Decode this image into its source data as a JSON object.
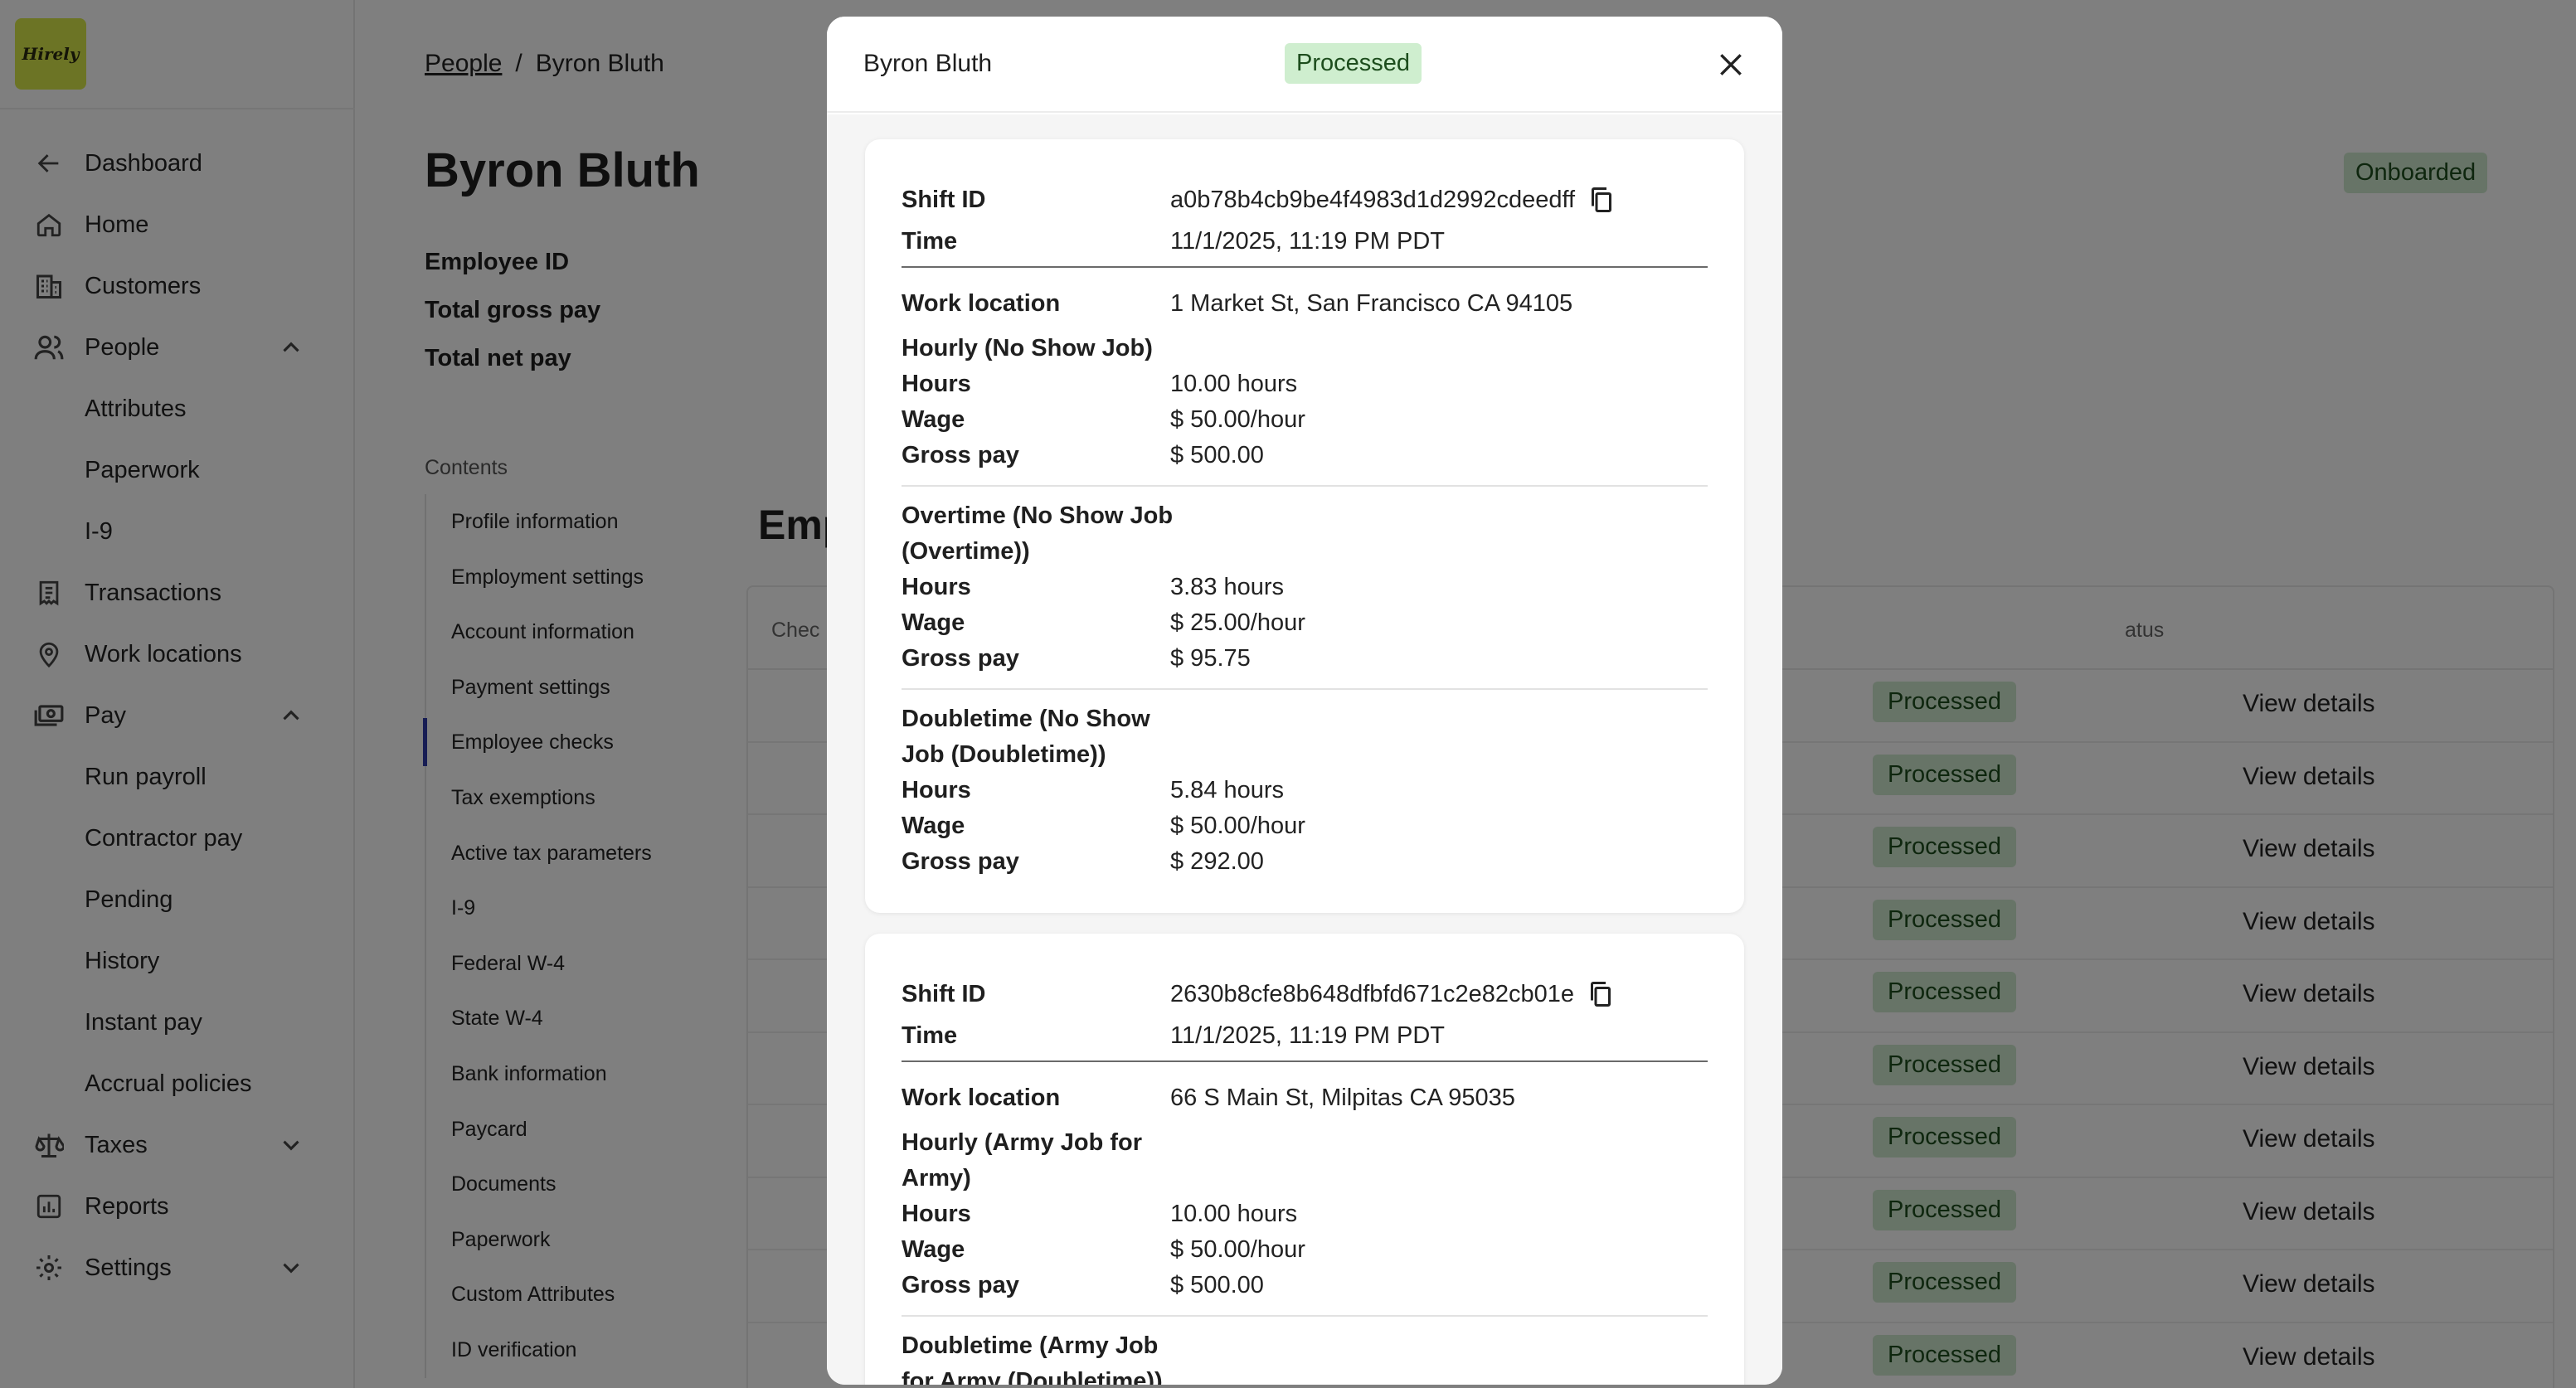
{
  "app": {
    "logo_text": "Hirely"
  },
  "sidebar": {
    "items": [
      {
        "label": "Dashboard",
        "icon": "arrow-left-icon"
      },
      {
        "label": "Home",
        "icon": "home-icon"
      },
      {
        "label": "Customers",
        "icon": "building-icon"
      },
      {
        "label": "People",
        "icon": "users-icon",
        "expanded": true
      },
      {
        "label": "Attributes"
      },
      {
        "label": "Paperwork"
      },
      {
        "label": "I-9"
      },
      {
        "label": "Transactions",
        "icon": "receipt-icon"
      },
      {
        "label": "Work locations",
        "icon": "map-pin-icon"
      },
      {
        "label": "Pay",
        "icon": "money-icon",
        "expanded": true
      },
      {
        "label": "Run payroll"
      },
      {
        "label": "Contractor pay"
      },
      {
        "label": "Pending"
      },
      {
        "label": "History"
      },
      {
        "label": "Instant pay"
      },
      {
        "label": "Accrual policies"
      },
      {
        "label": "Taxes",
        "icon": "scale-icon",
        "expanded": false
      },
      {
        "label": "Reports",
        "icon": "chart-icon"
      },
      {
        "label": "Settings",
        "icon": "gear-icon",
        "expanded": false
      }
    ]
  },
  "breadcrumb": {
    "parent": "People",
    "separator": "/",
    "current": "Byron Bluth"
  },
  "page": {
    "title": "Byron Bluth",
    "status": "Onboarded",
    "summary": {
      "employee_id": "Employee ID",
      "total_gross_pay": "Total gross pay",
      "total_net_pay": "Total net pay"
    },
    "contents_title": "Contents",
    "contents": [
      "Profile information",
      "Employment settings",
      "Account information",
      "Payment settings",
      "Employee checks",
      "Tax exemptions",
      "Active tax parameters",
      "I-9",
      "Federal W-4",
      "State W-4",
      "Bank information",
      "Paycard",
      "Documents",
      "Paperwork",
      "Custom Attributes",
      "ID verification"
    ],
    "active_contents_index": 4,
    "section_title": "Emp",
    "table": {
      "col_check": "Chec",
      "col_status": "atus",
      "rows": [
        {
          "status": "Processed",
          "action": "View details"
        },
        {
          "status": "Processed",
          "action": "View details"
        },
        {
          "status": "Processed",
          "action": "View details"
        },
        {
          "status": "Processed",
          "action": "View details"
        },
        {
          "status": "Processed",
          "action": "View details"
        },
        {
          "status": "Processed",
          "action": "View details"
        },
        {
          "status": "Processed",
          "action": "View details"
        },
        {
          "status": "Processed",
          "action": "View details"
        },
        {
          "status": "Processed",
          "action": "View details"
        },
        {
          "status": "Processed",
          "action": "View details"
        }
      ]
    }
  },
  "modal": {
    "title": "Byron Bluth",
    "status": "Processed",
    "labels": {
      "shift_id": "Shift ID",
      "time": "Time",
      "work_location": "Work location",
      "hours": "Hours",
      "wage": "Wage",
      "gross_pay": "Gross pay"
    },
    "shifts": [
      {
        "shift_id": "a0b78b4cb9be4f4983d1d2992cdeedff",
        "time": "11/1/2025, 11:19 PM PDT",
        "work_location": "1 Market St, San Francisco CA 94105",
        "groups": [
          {
            "title": "Hourly (No Show Job)",
            "hours": "10.00 hours",
            "wage": "$ 50.00/hour",
            "gross_pay": "$ 500.00"
          },
          {
            "title": "Overtime (No Show Job (Overtime))",
            "hours": "3.83 hours",
            "wage": "$ 25.00/hour",
            "gross_pay": "$ 95.75"
          },
          {
            "title": "Doubletime (No Show Job (Doubletime))",
            "hours": "5.84 hours",
            "wage": "$ 50.00/hour",
            "gross_pay": "$ 292.00"
          }
        ]
      },
      {
        "shift_id": "2630b8cfe8b648dfbfd671c2e82cb01e",
        "time": "11/1/2025, 11:19 PM PDT",
        "work_location": "66 S Main St, Milpitas CA 95035",
        "groups": [
          {
            "title": "Hourly (Army Job for Army)",
            "hours": "10.00 hours",
            "wage": "$ 50.00/hour",
            "gross_pay": "$ 500.00"
          },
          {
            "title": "Doubletime (Army Job for Army (Doubletime))",
            "hours": "",
            "wage": "",
            "gross_pay": ""
          }
        ]
      }
    ]
  }
}
